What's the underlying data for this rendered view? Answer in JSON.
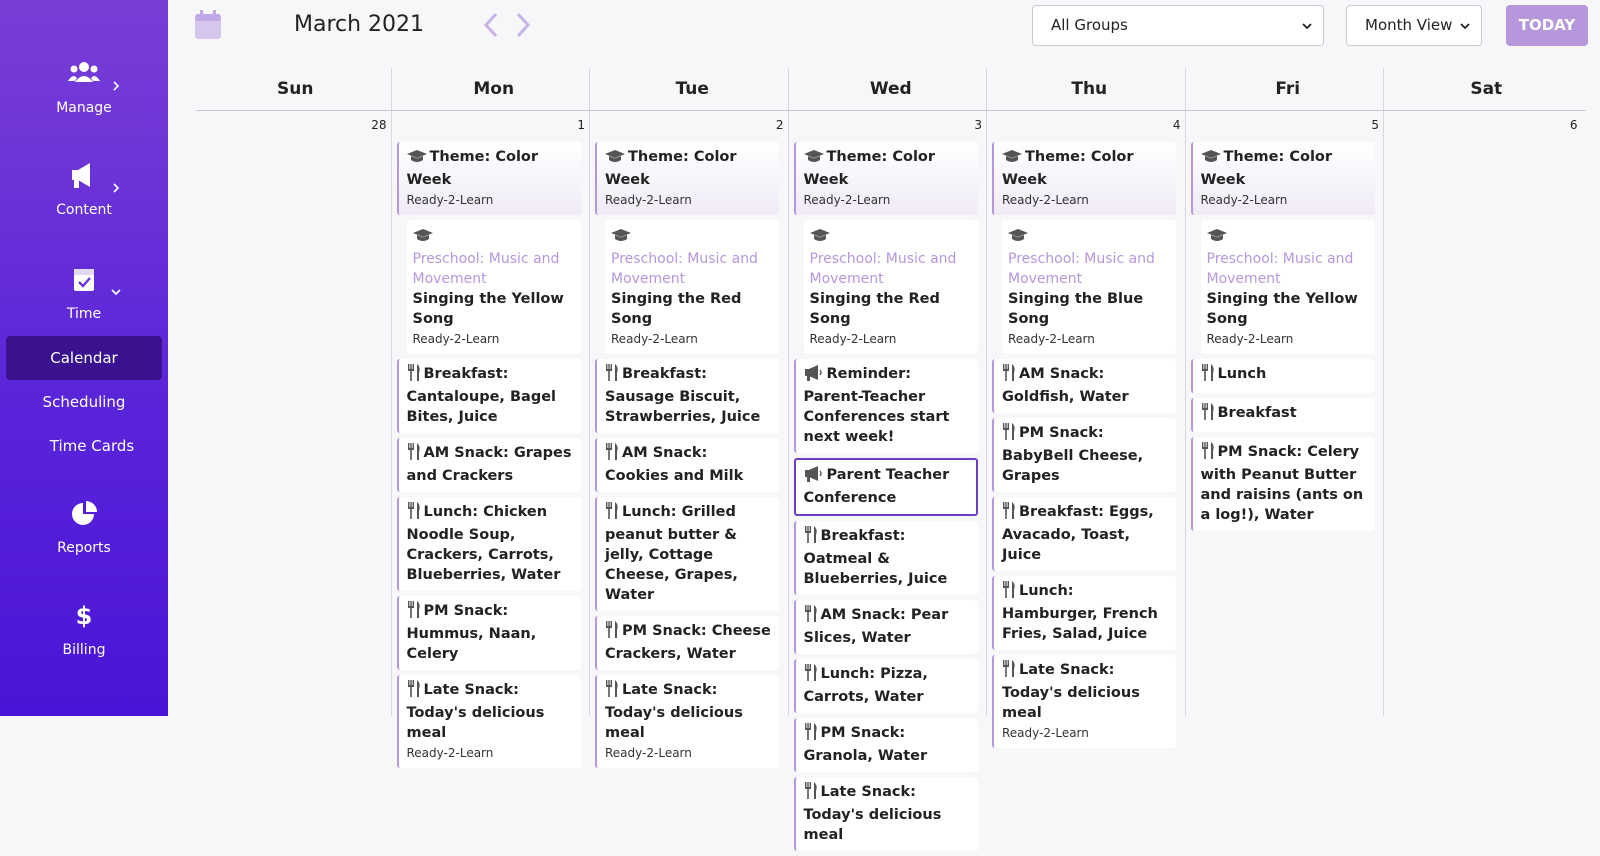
{
  "sidebar": {
    "manage": "Manage",
    "content": "Content",
    "time": "Time",
    "sub_items": [
      "Calendar",
      "Scheduling",
      "Time Cards"
    ],
    "reports": "Reports",
    "billing": "Billing"
  },
  "header": {
    "month": "March 2021",
    "group_select": "All Groups",
    "view_select": "Month View",
    "today": "TODAY"
  },
  "colors": {
    "accent": "#b697dc",
    "sidebar_top": "#7a3ed6",
    "sidebar_bottom": "#4a14d8",
    "selected_border": "#6d3fc4"
  },
  "days": [
    "Sun",
    "Mon",
    "Tue",
    "Wed",
    "Thu",
    "Fri",
    "Sat"
  ],
  "dates": [
    "28",
    "1",
    "2",
    "3",
    "4",
    "5",
    "6"
  ],
  "columns": [
    {
      "events": []
    },
    {
      "events": [
        {
          "kind": "theme",
          "icon": "graduation-cap-icon",
          "title": "Theme: Color Week",
          "sub": "Ready-2-Learn"
        },
        {
          "kind": "activity",
          "icon": "graduation-cap-icon",
          "category": "Preschool: Music and Movement",
          "title": "Singing the Yellow Song",
          "sub": "Ready-2-Learn"
        },
        {
          "kind": "meal",
          "icon": "fork-knife-icon",
          "title": "Breakfast: Cantaloupe, Bagel Bites, Juice"
        },
        {
          "kind": "meal",
          "icon": "fork-knife-icon",
          "title": "AM Snack: Grapes and Crackers"
        },
        {
          "kind": "meal",
          "icon": "fork-knife-icon",
          "title": "Lunch: Chicken Noodle Soup, Crackers, Carrots, Blueberries, Water"
        },
        {
          "kind": "meal",
          "icon": "fork-knife-icon",
          "title": "PM Snack: Hummus, Naan, Celery"
        },
        {
          "kind": "meal",
          "icon": "fork-knife-icon",
          "title": "Late Snack: Today's delicious meal",
          "sub": "Ready-2-Learn"
        }
      ]
    },
    {
      "events": [
        {
          "kind": "theme",
          "icon": "graduation-cap-icon",
          "title": "Theme: Color Week",
          "sub": "Ready-2-Learn"
        },
        {
          "kind": "activity",
          "icon": "graduation-cap-icon",
          "category": "Preschool: Music and Movement",
          "title": "Singing the Red Song",
          "sub": "Ready-2-Learn"
        },
        {
          "kind": "meal",
          "icon": "fork-knife-icon",
          "title": "Breakfast: Sausage Biscuit, Strawberries, Juice"
        },
        {
          "kind": "meal",
          "icon": "fork-knife-icon",
          "title": "AM Snack: Cookies and Milk"
        },
        {
          "kind": "meal",
          "icon": "fork-knife-icon",
          "title": "Lunch: Grilled peanut butter & jelly, Cottage Cheese, Grapes, Water"
        },
        {
          "kind": "meal",
          "icon": "fork-knife-icon",
          "title": "PM Snack: Cheese Crackers, Water"
        },
        {
          "kind": "meal",
          "icon": "fork-knife-icon",
          "title": "Late Snack: Today's delicious meal",
          "sub": "Ready-2-Learn"
        }
      ]
    },
    {
      "events": [
        {
          "kind": "theme",
          "icon": "graduation-cap-icon",
          "title": "Theme: Color Week",
          "sub": "Ready-2-Learn"
        },
        {
          "kind": "activity",
          "icon": "graduation-cap-icon",
          "category": "Preschool: Music and Movement",
          "title": "Singing the Red Song",
          "sub": "Ready-2-Learn"
        },
        {
          "kind": "announcement",
          "icon": "megaphone-icon",
          "title": "Reminder: Parent-Teacher Conferences start next week!"
        },
        {
          "kind": "announcement",
          "icon": "megaphone-icon",
          "title": "Parent Teacher Conference",
          "selected": true
        },
        {
          "kind": "meal",
          "icon": "fork-knife-icon",
          "title": "Breakfast: Oatmeal & Blueberries, Juice"
        },
        {
          "kind": "meal",
          "icon": "fork-knife-icon",
          "title": "AM Snack: Pear Slices, Water"
        },
        {
          "kind": "meal",
          "icon": "fork-knife-icon",
          "title": "Lunch: Pizza, Carrots, Water"
        },
        {
          "kind": "meal",
          "icon": "fork-knife-icon",
          "title": "PM Snack: Granola, Water"
        },
        {
          "kind": "meal",
          "icon": "fork-knife-icon",
          "title": "Late Snack: Today's delicious meal"
        }
      ]
    },
    {
      "events": [
        {
          "kind": "theme",
          "icon": "graduation-cap-icon",
          "title": "Theme: Color Week",
          "sub": "Ready-2-Learn"
        },
        {
          "kind": "activity",
          "icon": "graduation-cap-icon",
          "category": "Preschool: Music and Movement",
          "title": "Singing the Blue Song",
          "sub": "Ready-2-Learn"
        },
        {
          "kind": "meal",
          "icon": "fork-knife-icon",
          "title": "AM Snack: Goldfish, Water"
        },
        {
          "kind": "meal",
          "icon": "fork-knife-icon",
          "title": "PM Snack: BabyBell Cheese, Grapes"
        },
        {
          "kind": "meal",
          "icon": "fork-knife-icon",
          "title": "Breakfast: Eggs, Avacado, Toast, Juice"
        },
        {
          "kind": "meal",
          "icon": "fork-knife-icon",
          "title": "Lunch: Hamburger, French Fries, Salad, Juice"
        },
        {
          "kind": "meal",
          "icon": "fork-knife-icon",
          "title": "Late Snack: Today's delicious meal",
          "sub": "Ready-2-Learn"
        }
      ]
    },
    {
      "events": [
        {
          "kind": "theme",
          "icon": "graduation-cap-icon",
          "title": "Theme: Color Week",
          "sub": "Ready-2-Learn"
        },
        {
          "kind": "activity",
          "icon": "graduation-cap-icon",
          "category": "Preschool: Music and Movement",
          "title": "Singing the Yellow Song",
          "sub": "Ready-2-Learn"
        },
        {
          "kind": "meal",
          "icon": "fork-knife-icon",
          "title": "Lunch"
        },
        {
          "kind": "meal",
          "icon": "fork-knife-icon",
          "title": "Breakfast"
        },
        {
          "kind": "meal",
          "icon": "fork-knife-icon",
          "title": "PM Snack: Celery with Peanut Butter and raisins (ants on a log!), Water"
        }
      ]
    },
    {
      "events": []
    }
  ]
}
